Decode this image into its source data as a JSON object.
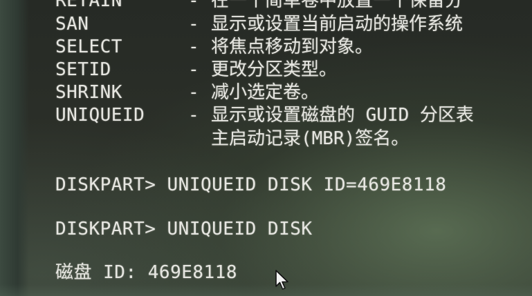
{
  "help_rows": [
    {
      "cmd": "RETAIN",
      "desc": "在一个简单卷中放置一个保留分"
    },
    {
      "cmd": "SAN",
      "desc": "显示或设置当前启动的操作系统"
    },
    {
      "cmd": "SELECT",
      "desc": "将焦点移动到对象。"
    },
    {
      "cmd": "SETID",
      "desc": "更改分区类型。"
    },
    {
      "cmd": "SHRINK",
      "desc": "减小选定卷。"
    },
    {
      "cmd": "UNIQUEID",
      "desc": "显示或设置磁盘的 GUID 分区表"
    }
  ],
  "help_continuation": "主启动记录(MBR)签名。",
  "separator": "-",
  "commands": [
    "DISKPART> UNIQUEID DISK ID=469E8118",
    "DISKPART> UNIQUEID DISK"
  ],
  "output": "磁盘 ID: 469E8118",
  "colors": {
    "text": "#e6e6e1",
    "background": "#2c302a"
  },
  "cursor_icon": "mouse-pointer-icon"
}
